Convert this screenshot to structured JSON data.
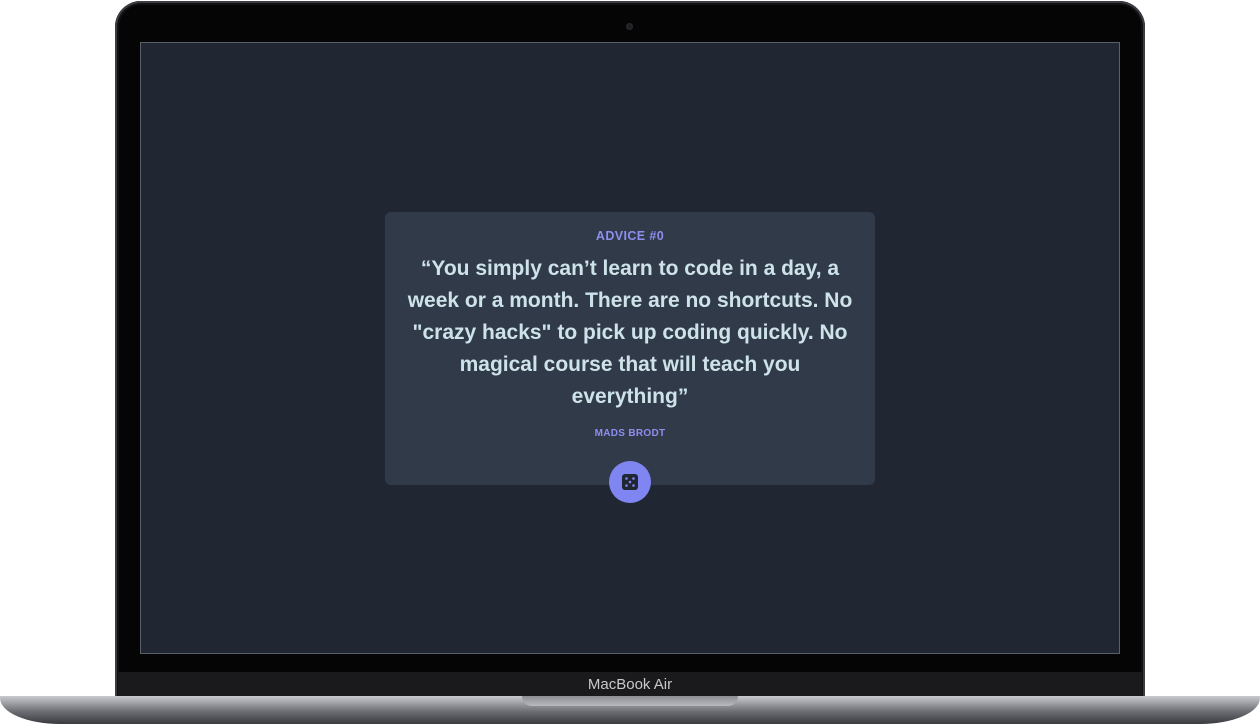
{
  "device": {
    "brand_label": "MacBook Air"
  },
  "advice": {
    "id_label": "ADVICE #0",
    "quote": "“You simply can’t learn to code in a day, a week or a month. There are no shortcuts. No \"crazy hacks\" to pick up coding quickly. No magical course that will teach you everything”",
    "author": "MADS BRODT",
    "dice_button_icon": "dice-icon"
  },
  "colors": {
    "screen_background": "#202632",
    "card_background": "#313a48",
    "accent": "#8d8ef0",
    "quote_text": "#cee3e9",
    "button": "#7f86f2"
  }
}
